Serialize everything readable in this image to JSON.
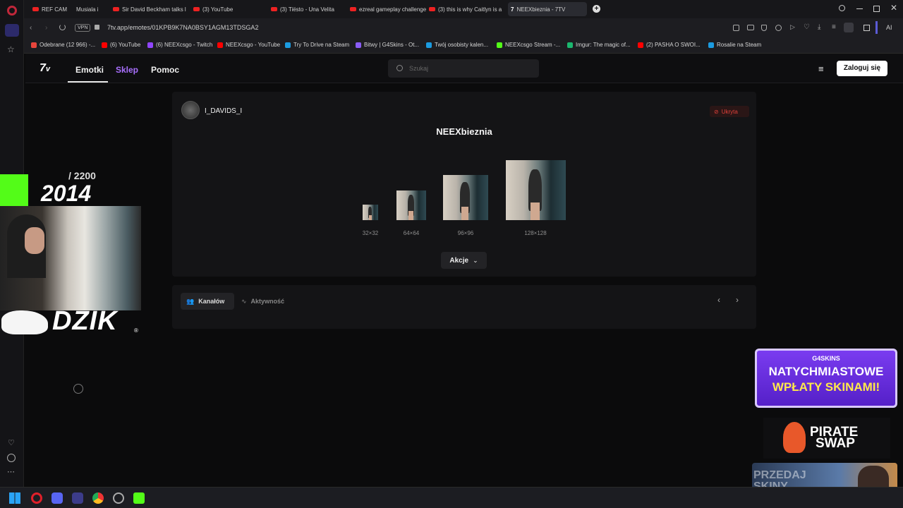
{
  "browser": {
    "tabs": [
      {
        "label": "REF CAM"
      },
      {
        "label": "Musiala i"
      },
      {
        "label": "Sir David Beckham talks l"
      },
      {
        "label": "(3) YouTube"
      },
      {
        "label": "(3) Tiësto - Una Velita"
      },
      {
        "label": "ezreal gameplay challenge"
      },
      {
        "label": "(3) this is why Caitlyn is a"
      },
      {
        "label": "NEEXbieznia - 7TV"
      }
    ],
    "url": "7tv.app/emotes/01KPB9K7NA0BSY1AGM13TDSGA2",
    "vpn_label": "VPN",
    "ai_label": "AI",
    "bookmarks": [
      {
        "label": "Odebrane (12 966) -...",
        "color": "#e8453c"
      },
      {
        "label": "(6) YouTube",
        "color": "#ff0000"
      },
      {
        "label": "(6) NEEXcsgo - Twitch",
        "color": "#9146ff"
      },
      {
        "label": "NEEXcsgo - YouTube",
        "color": "#ff0000"
      },
      {
        "label": "Try To Drive na Steam",
        "color": "#1b9be0"
      },
      {
        "label": "Bitwy | G4Skins - Ot...",
        "color": "#8a5cf6"
      },
      {
        "label": "Twój osobisty kalen...",
        "color": "#1b9be0"
      },
      {
        "label": "NEEXcsgo Stream -...",
        "color": "#53fc18"
      },
      {
        "label": "Imgur: The magic of...",
        "color": "#1bb76e"
      },
      {
        "label": "(2) PASHA O SWOI...",
        "color": "#ff0000"
      },
      {
        "label": "Rosalie na Steam",
        "color": "#1b9be0"
      }
    ]
  },
  "site": {
    "nav": {
      "emotes": "Emotki",
      "store": "Sklep",
      "help": "Pomoc"
    },
    "search_placeholder": "Szukaj",
    "login_label": "Zaloguj się",
    "emote": {
      "owner": "I_DAVIDS_I",
      "name": "NEEXbieznia",
      "status": "Ukryta",
      "sizes": [
        "32×32",
        "64×64",
        "96×96",
        "128×128"
      ],
      "actions_label": "Akcje"
    },
    "tabs": {
      "channels": "Kanałów",
      "activity": "Aktywność"
    }
  },
  "overlay": {
    "counter_total": "/ 2200",
    "counter_value": "2014",
    "brand": "DZIK",
    "brand_mark": "®",
    "ad1_logo": "G4SKINS",
    "ad1_line1": "NATYCHMIASTOWE",
    "ad1_line2": "WPŁATY SKINAMI!",
    "ad2_line1": "PIRATE",
    "ad2_line2": "SWAP",
    "ad3_text": "PRZEDAJ SKINY"
  },
  "colors": {
    "accent": "#a970ff",
    "status_red": "#e0403a",
    "kick_green": "#53fc18"
  }
}
